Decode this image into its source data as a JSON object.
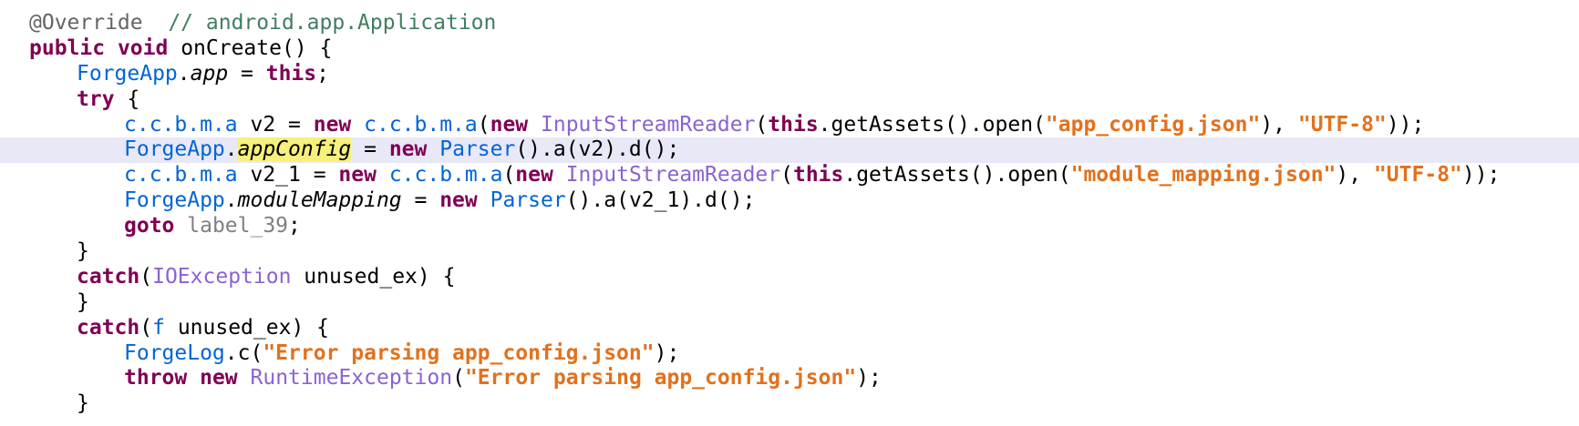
{
  "editor": {
    "lines": [
      {
        "indent": 0,
        "tokens": [
          {
            "text": "@Override",
            "kind": "ann"
          },
          {
            "text": "  ",
            "kind": "plain"
          },
          {
            "text": "// android.app.Application",
            "kind": "cmt"
          }
        ]
      },
      {
        "indent": 0,
        "tokens": [
          {
            "text": "public",
            "kind": "kw"
          },
          {
            "text": " ",
            "kind": "plain"
          },
          {
            "text": "void",
            "kind": "kw"
          },
          {
            "text": " onCreate() {",
            "kind": "plain"
          }
        ]
      },
      {
        "indent": 1,
        "tokens": [
          {
            "text": "ForgeApp",
            "kind": "cls"
          },
          {
            "text": ".",
            "kind": "plain"
          },
          {
            "text": "app",
            "kind": "fld"
          },
          {
            "text": " = ",
            "kind": "plain"
          },
          {
            "text": "this",
            "kind": "kw"
          },
          {
            "text": ";",
            "kind": "plain"
          }
        ]
      },
      {
        "indent": 1,
        "tokens": [
          {
            "text": "try",
            "kind": "kw"
          },
          {
            "text": " {",
            "kind": "plain"
          }
        ]
      },
      {
        "indent": 2,
        "tokens": [
          {
            "text": "c.c.b.m.a",
            "kind": "cls"
          },
          {
            "text": " v2 = ",
            "kind": "plain"
          },
          {
            "text": "new",
            "kind": "kw"
          },
          {
            "text": " ",
            "kind": "plain"
          },
          {
            "text": "c.c.b.m.a",
            "kind": "cls"
          },
          {
            "text": "(",
            "kind": "plain"
          },
          {
            "text": "new",
            "kind": "kw"
          },
          {
            "text": " ",
            "kind": "plain"
          },
          {
            "text": "InputStreamReader",
            "kind": "type2"
          },
          {
            "text": "(",
            "kind": "plain"
          },
          {
            "text": "this",
            "kind": "kw"
          },
          {
            "text": ".getAssets().open(",
            "kind": "plain"
          },
          {
            "text": "\"app_config.json\"",
            "kind": "str"
          },
          {
            "text": "), ",
            "kind": "plain"
          },
          {
            "text": "\"UTF-8\"",
            "kind": "str"
          },
          {
            "text": "));",
            "kind": "plain"
          }
        ]
      },
      {
        "indent": 2,
        "current": true,
        "tokens": [
          {
            "text": "ForgeApp",
            "kind": "cls"
          },
          {
            "text": ".",
            "kind": "plain"
          },
          {
            "text": "appConfig",
            "kind": "hl"
          },
          {
            "text": " = ",
            "kind": "plain"
          },
          {
            "text": "new",
            "kind": "kw"
          },
          {
            "text": " ",
            "kind": "plain"
          },
          {
            "text": "Parser",
            "kind": "cls"
          },
          {
            "text": "().a(v2).d();",
            "kind": "plain"
          }
        ]
      },
      {
        "indent": 2,
        "tokens": [
          {
            "text": "c.c.b.m.a",
            "kind": "cls"
          },
          {
            "text": " v2_1 = ",
            "kind": "plain"
          },
          {
            "text": "new",
            "kind": "kw"
          },
          {
            "text": " ",
            "kind": "plain"
          },
          {
            "text": "c.c.b.m.a",
            "kind": "cls"
          },
          {
            "text": "(",
            "kind": "plain"
          },
          {
            "text": "new",
            "kind": "kw"
          },
          {
            "text": " ",
            "kind": "plain"
          },
          {
            "text": "InputStreamReader",
            "kind": "type2"
          },
          {
            "text": "(",
            "kind": "plain"
          },
          {
            "text": "this",
            "kind": "kw"
          },
          {
            "text": ".getAssets().open(",
            "kind": "plain"
          },
          {
            "text": "\"module_mapping.json\"",
            "kind": "str"
          },
          {
            "text": "), ",
            "kind": "plain"
          },
          {
            "text": "\"UTF-8\"",
            "kind": "str"
          },
          {
            "text": "));",
            "kind": "plain"
          }
        ]
      },
      {
        "indent": 2,
        "tokens": [
          {
            "text": "ForgeApp",
            "kind": "cls"
          },
          {
            "text": ".",
            "kind": "plain"
          },
          {
            "text": "moduleMapping",
            "kind": "fld"
          },
          {
            "text": " = ",
            "kind": "plain"
          },
          {
            "text": "new",
            "kind": "kw"
          },
          {
            "text": " ",
            "kind": "plain"
          },
          {
            "text": "Parser",
            "kind": "cls"
          },
          {
            "text": "().a(v2_1).d();",
            "kind": "plain"
          }
        ]
      },
      {
        "indent": 2,
        "tokens": [
          {
            "text": "goto",
            "kind": "kw"
          },
          {
            "text": " ",
            "kind": "plain"
          },
          {
            "text": "label_39",
            "kind": "lbl"
          },
          {
            "text": ";",
            "kind": "plain"
          }
        ]
      },
      {
        "indent": 1,
        "tokens": [
          {
            "text": "}",
            "kind": "plain"
          }
        ]
      },
      {
        "indent": 1,
        "tokens": [
          {
            "text": "catch",
            "kind": "kw"
          },
          {
            "text": "(",
            "kind": "plain"
          },
          {
            "text": "IOException",
            "kind": "type2"
          },
          {
            "text": " unused_ex) {",
            "kind": "plain"
          }
        ]
      },
      {
        "indent": 1,
        "tokens": [
          {
            "text": "}",
            "kind": "plain"
          }
        ]
      },
      {
        "indent": 1,
        "tokens": [
          {
            "text": "catch",
            "kind": "kw"
          },
          {
            "text": "(",
            "kind": "plain"
          },
          {
            "text": "f",
            "kind": "cls"
          },
          {
            "text": " unused_ex) {",
            "kind": "plain"
          }
        ]
      },
      {
        "indent": 2,
        "tokens": [
          {
            "text": "ForgeLog",
            "kind": "cls"
          },
          {
            "text": ".c(",
            "kind": "plain"
          },
          {
            "text": "\"Error parsing app_config.json\"",
            "kind": "str"
          },
          {
            "text": ");",
            "kind": "plain"
          }
        ]
      },
      {
        "indent": 2,
        "tokens": [
          {
            "text": "throw",
            "kind": "kw"
          },
          {
            "text": " ",
            "kind": "plain"
          },
          {
            "text": "new",
            "kind": "kw"
          },
          {
            "text": " ",
            "kind": "plain"
          },
          {
            "text": "RuntimeException",
            "kind": "type2"
          },
          {
            "text": "(",
            "kind": "plain"
          },
          {
            "text": "\"Error parsing app_config.json\"",
            "kind": "str"
          },
          {
            "text": ");",
            "kind": "plain"
          }
        ]
      },
      {
        "indent": 1,
        "tokens": [
          {
            "text": "}",
            "kind": "plain"
          }
        ]
      }
    ]
  },
  "colors": {
    "keyword": "#7f0055",
    "class": "#0064d8",
    "type": "#8a63d2",
    "string": "#e2711d",
    "annotation": "#646464",
    "comment": "#3f7f5f",
    "highlight": "#f6f07c",
    "current_line": "#e8e8f7"
  }
}
